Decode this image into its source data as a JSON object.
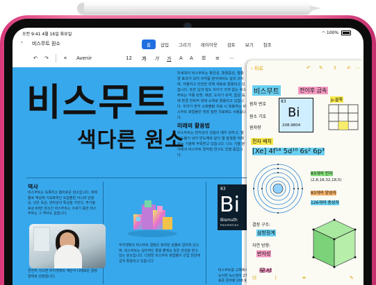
{
  "status_bar": {
    "time": "오전 9:41",
    "date": "4월 16일 화요일",
    "battery": "100%"
  },
  "nav": {
    "back": "‹",
    "doc_title": "비스무트 원소"
  },
  "tabs": [
    "홈",
    "삽입",
    "그리기",
    "레이아웃",
    "검토",
    "보기",
    "참조"
  ],
  "toolbar": {
    "font": "Avenir",
    "size": "12",
    "bold": "가",
    "italic": "가",
    "grow": "가",
    "shrink": "A",
    "font_size_up": "A"
  },
  "document": {
    "headline": "비스무트",
    "subheadline": "색다른 원소",
    "right_col_top": "차세대의 비스무트는 항균성, 항염증성, 항종양 효과가 있어 의약품 분야에서도 널리 쓰이며, 저렴하고 안전한 대체 재료로 활용되고 있습니다. 또한 납과 밀도 차이가 크게 없는 비스무트는 각종 탄환, 배관, 도자기 유약, 합금 등에 환경 친화적 대체 소재로 활용되고 있습니다. 우리가 흔히 소화불량 치료 시 복용하는 비스무트 화합물은 위장 질환 치료에도 사용됩니다.",
    "right_col_heading": "미래의 활용법",
    "right_col_bottom": "비스무트는 반자성이 성질이 매우 강하고, 열전도율이 낮아 반도체와 같이 열 발생을 억제하는 기술에 주목받고 있습니다. 나노 기술 분야에서 비스무트 양자점 연구도 진행 중입니다.",
    "section_title": "역사",
    "section_body": "비스무트는 독특하고 흥미로운 원소입니다. 대체물로 액상에 기묘화학인 모습뿐만 아니라 안정성, 낮은 독성, 반자성의 특성을 가진다. 주기율표상 83번 원소인 비스무트는 수세기 동안 비스무트는 그 역사도 깊습니다.",
    "section_body2": "천천히 식으면 무지갯빛의 계단식 다채로운 결정 형태로 성장합니다.",
    "art_caption": "무지갯빛의 비스무트 결정은 화려한 광물로 알려져 있으며, 비스무트는 실리적인 활용 뿐에도 많은 관심을 받고 있는 원소입니다. 다양한 비스무트 화합물이 산업 전반에 걸쳐 활용되고 있습니다.",
    "below_tile": "비스무트를 고체에서 액체로 녹이면 녹는점이 271.4°C, 표준 원자량 208.98 이다."
  },
  "element_tile": {
    "number": "83",
    "symbol": "Bi",
    "name": "Bismuth",
    "properties": "PROPERTIES"
  },
  "notes": {
    "back_label": "뒤로",
    "title": "비스무트",
    "subtitle": "전이후 금속",
    "atomic_label": "원자 번호",
    "atomic_number": "83",
    "symbol": "Bi",
    "mass_label": "원자량",
    "mass_value": "208.9804",
    "element_label": "원소 기호",
    "p_block": "p-블록",
    "config_heading": "전자 배치",
    "config": "[Xe] 4f¹⁴ 5d¹⁰ 6s² 6p³",
    "shells_label": "83개의 전자",
    "shells": "(2,8,18,32,18,5)",
    "protons": "83개의 양성자",
    "neutrons": "126개의 중성자",
    "structure_label": "결정 구조:",
    "structure_value": "삼방정계",
    "magnetic_label": "자연 방향:",
    "magnetic_value": "반자성",
    "state_label": "물성"
  },
  "colors": {
    "doc_bg": "#38a8ec",
    "tab_active": "#1f6fe0",
    "chassis": "#f07aa6",
    "notes_accent": "#e0a100"
  }
}
